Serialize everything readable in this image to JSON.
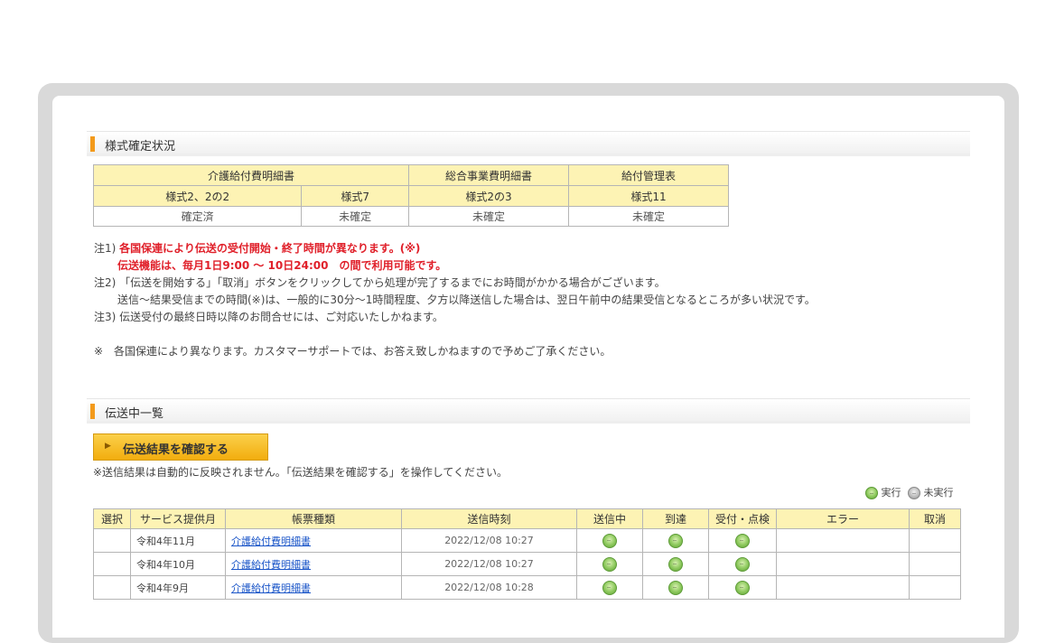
{
  "section1": {
    "title": "様式確定状況"
  },
  "status_table": {
    "groups": [
      "介護給付費明細書",
      "総合事業費明細書",
      "給付管理表"
    ],
    "forms": [
      "様式2、2の2",
      "様式7",
      "様式2の3",
      "様式11"
    ],
    "values": [
      "確定済",
      "未確定",
      "未確定",
      "未確定"
    ]
  },
  "notes": {
    "n1_prefix": "注1)",
    "n1_red": "各国保連により伝送の受付開始・終了時間が異なります。(※)",
    "n1_red2": "伝送機能は、毎月1日9:00 ～ 10日24:00　の間で利用可能です。",
    "n2": "注2) 「伝送を開始する」「取消」ボタンをクリックしてから処理が完了するまでにお時間がかかる場合がございます。",
    "n2b": "送信～結果受信までの時間(※)は、一般的に30分～1時間程度、夕方以降送信した場合は、翌日午前中の結果受信となるところが多い状況です。",
    "n3": "注3) 伝送受付の最終日時以降のお問合せには、ご対応いたしかねます。",
    "footnote": "※　各国保連により異なります。カスタマーサポートでは、お答え致しかねますので予めご了承ください。"
  },
  "section2": {
    "title": "伝送中一覧"
  },
  "confirm_button": {
    "label": "伝送結果を確認する"
  },
  "hint": "※送信結果は自動的に反映されません。「伝送結果を確認する」を操作してください。",
  "legend": {
    "executed": "実行",
    "not_executed": "未実行",
    "executed_icon": "green-circle-icon",
    "not_executed_icon": "gray-circle-icon"
  },
  "trans_table": {
    "headers": [
      "選択",
      "サービス提供月",
      "帳票種類",
      "送信時刻",
      "送信中",
      "到達",
      "受付・点検",
      "エラー",
      "取消"
    ],
    "rows": [
      {
        "month": "令和4年11月",
        "type": "介護給付費明細書",
        "time": "2022/12/08 10:27",
        "sending": "実行",
        "arrived": "実行",
        "accepted": "実行"
      },
      {
        "month": "令和4年10月",
        "type": "介護給付費明細書",
        "time": "2022/12/08 10:27",
        "sending": "実行",
        "arrived": "実行",
        "accepted": "実行"
      },
      {
        "month": "令和4年9月",
        "type": "介護給付費明細書",
        "time": "2022/12/08 10:28",
        "sending": "実行",
        "arrived": "実行",
        "accepted": "実行"
      }
    ]
  },
  "colors": {
    "accent": "#f39a1b",
    "header_bg": "#fdf3b4",
    "note_red": "#e0202a",
    "link": "#1a55c8",
    "button": "#f7be2a"
  }
}
